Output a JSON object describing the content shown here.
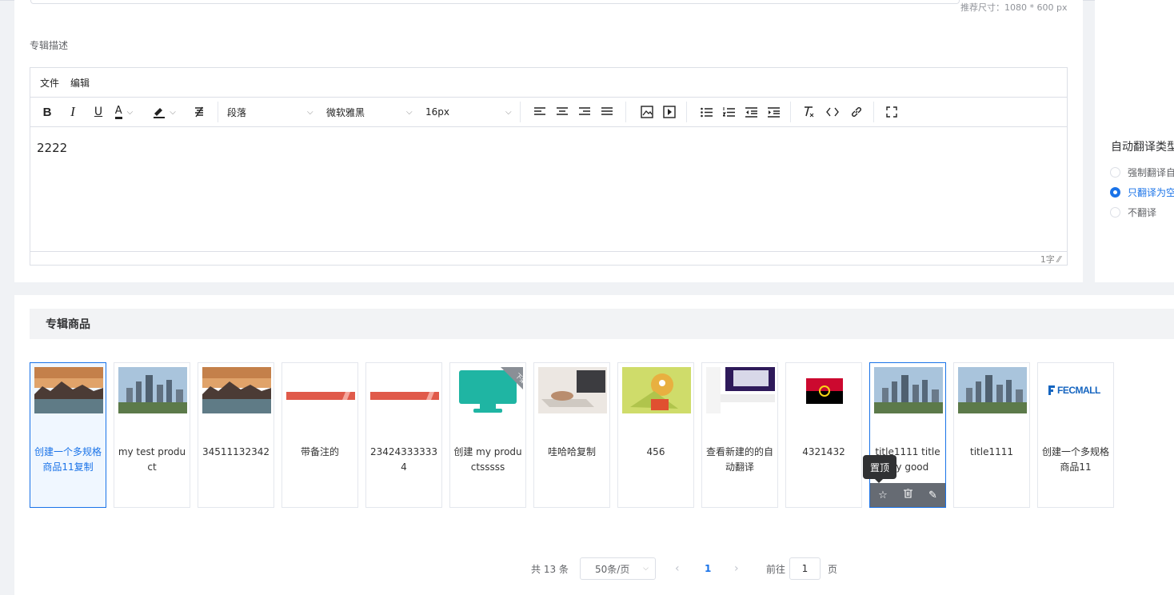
{
  "cover": {
    "size_hint": "推荐尺寸：1080 * 600 px"
  },
  "description": {
    "label": "专辑描述",
    "menu": [
      "文件",
      "编辑"
    ],
    "toolbar": {
      "bold": "B",
      "italic": "I",
      "underline": "U",
      "font_color": "A",
      "paragraph": "段落",
      "font_family": "微软雅黑",
      "font_size": "16px"
    },
    "content": "2222",
    "word_count": "1字"
  },
  "auto_translate": {
    "title": "自动翻译类型",
    "options": [
      {
        "label": "强制翻译自",
        "checked": false
      },
      {
        "label": "只翻译为空",
        "checked": true
      },
      {
        "label": "不翻译",
        "checked": false
      }
    ]
  },
  "products": {
    "title": "专辑商品",
    "items": [
      {
        "name": "创建一个多规格商品11复制",
        "thumb": "mountain-lake"
      },
      {
        "name": "my test product",
        "thumb": "city-skyline"
      },
      {
        "name": "34511132342",
        "thumb": "mountain-lake"
      },
      {
        "name": "带备注的",
        "thumb": "red-stripe"
      },
      {
        "name": "234243333334",
        "thumb": "red-stripe"
      },
      {
        "name": "创建 my productsssss",
        "thumb": "teal-monitor",
        "badge": "下架"
      },
      {
        "name": "哇哈哈复制",
        "thumb": "laptop-desk"
      },
      {
        "name": "456",
        "thumb": "cartoon"
      },
      {
        "name": "查看新建的的自动翻译",
        "thumb": "website-screenshot"
      },
      {
        "name": "4321432",
        "thumb": "angola-flag"
      },
      {
        "name": "title1111 title my good",
        "thumb": "city-skyline"
      },
      {
        "name": "title1111",
        "thumb": "city-skyline"
      },
      {
        "name": "创建一个多规格商品11",
        "thumb": "fecmall-logo",
        "logo_text": "FECMALL"
      }
    ],
    "tooltip": "置顶"
  },
  "pagination": {
    "total": "共 13 条",
    "page_size": "50条/页",
    "current": "1",
    "goto_prefix": "前往",
    "goto_value": "1",
    "goto_suffix": "页"
  }
}
